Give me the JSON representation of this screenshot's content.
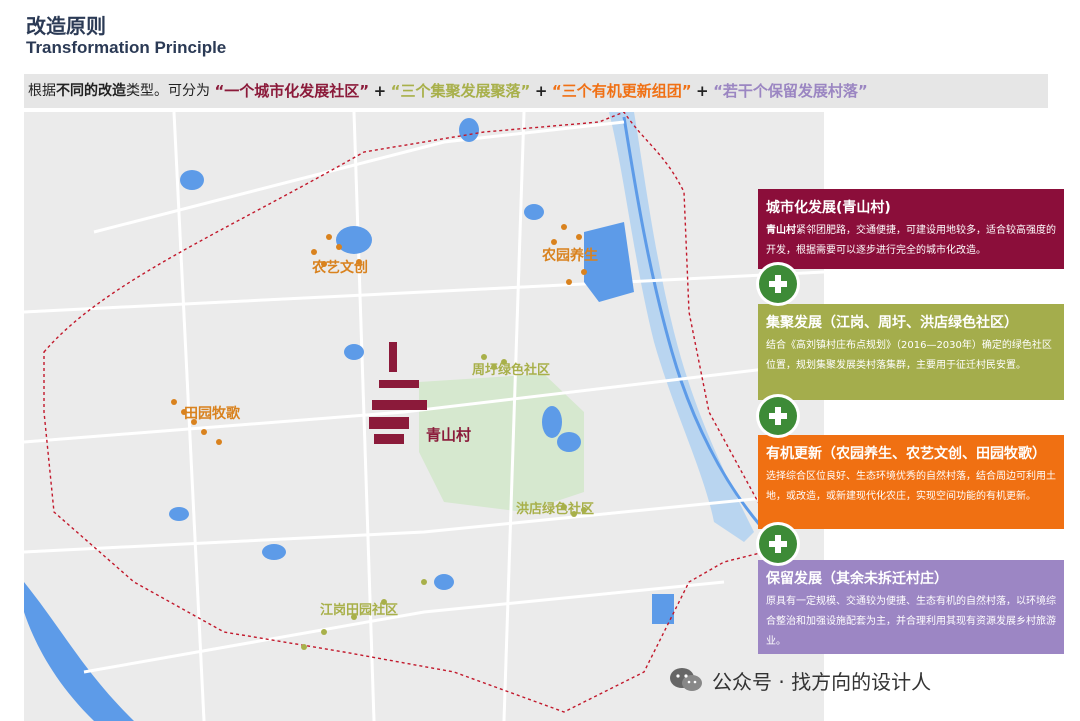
{
  "header": {
    "title_cn": "改造原则",
    "title_en": "Transformation Principle"
  },
  "intro": {
    "prefix": "根据",
    "bold": "不同的改造",
    "middle": "类型。可分为",
    "item1": "“一个城市化发展社区”",
    "plus": "+",
    "item2": "“三个集聚发展聚落”",
    "item3": "“三个有机更新组团”",
    "item4": "“若干个保留发展村落”",
    "colors": {
      "item1": "#8b1a3a",
      "item2": "#a8b04a",
      "item3": "#f07014",
      "item4": "#9b86c2"
    }
  },
  "map": {
    "labels": {
      "qingshan": "青山村",
      "nongyi": "农艺文创",
      "nongyuan": "农园养生",
      "zhouyu": "周圩绿色社区",
      "tianyuan": "田园牧歌",
      "hongdian": "洪店绿色社区",
      "jianggang": "江岗田园社区"
    },
    "colors": {
      "background": "#ebebeb",
      "road": "#ffffff",
      "water": "#5d9be8",
      "river": "#b9d5f0",
      "green": "#d6e8cf",
      "boundary": "#c2182b",
      "urban": "#8b1a3a",
      "organic": "#d9821e",
      "cluster": "#a8b04a",
      "keep": "#9b86c2"
    }
  },
  "panels": [
    {
      "title": "城市化发展(青山村)",
      "bold": "青山村",
      "body": "紧邻团肥路，交通便捷，可建设用地较多，适合较高强度的开发，根据需要可以逐步进行完全的城市化改造。",
      "color": "#8b0e3a"
    },
    {
      "title": "集聚发展（江岗、周圩、洪店绿色社区）",
      "body": "结合《高刘镇村庄布点规划》（2016—2030年）确定的绿色社区位置，规划集聚发展类村落集群，主要用于征迁村民安置。",
      "color": "#a4ad4c"
    },
    {
      "title": "有机更新（农园养生、农艺文创、田园牧歌）",
      "body": "选择综合区位良好、生态环境优秀的自然村落，结合周边可利用土地，或改造，或新建现代化农庄，实现空间功能的有机更新。",
      "color": "#f07012"
    },
    {
      "title": "保留发展（其余未拆迁村庄）",
      "body": "原具有一定规模、交通较为便捷、生态有机的自然村落，以环境综合整治和加强设施配套为主，并合理利用其现有资源发展乡村旅游业。",
      "color": "#9c86c4"
    }
  ],
  "plus_icons": [
    "plus-icon",
    "plus-icon",
    "plus-icon"
  ],
  "watermark": {
    "text": "公众号 · 找方向的设计人",
    "icon": "wechat-icon"
  }
}
